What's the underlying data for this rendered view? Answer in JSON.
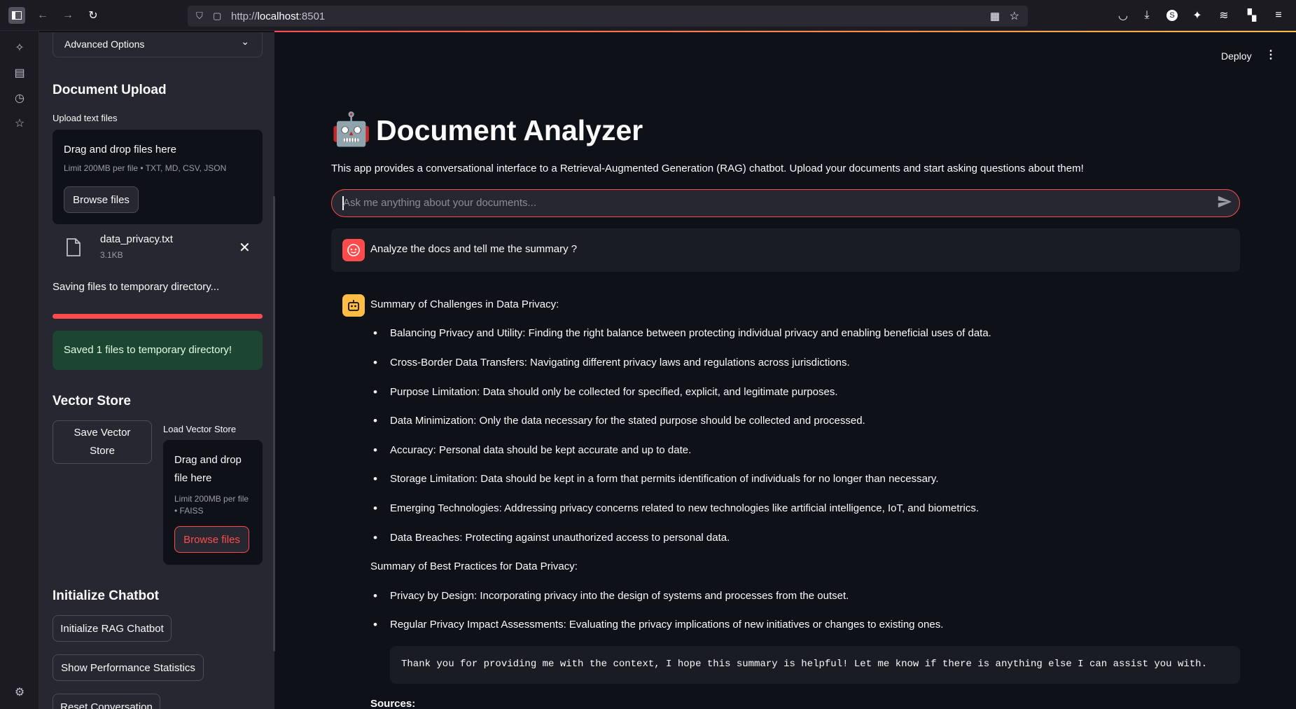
{
  "browser": {
    "url_prefix": "http://",
    "url_host": "localhost",
    "url_port": ":8501"
  },
  "sidebar": {
    "advanced_options": "Advanced Options",
    "document_upload_title": "Document Upload",
    "upload_label": "Upload text files",
    "drop_text": "Drag and drop files here",
    "drop_limit": "Limit 200MB per file • TXT, MD, CSV, JSON",
    "browse_button": "Browse files",
    "file_name": "data_privacy.txt",
    "file_size": "3.1KB",
    "saving_text": "Saving files to temporary directory...",
    "progress": 1.0,
    "success_text": "Saved 1 files to temporary directory!",
    "vector_store_title": "Vector Store",
    "save_vector_button": "Save Vector Store",
    "load_vector_label": "Load Vector Store",
    "load_drop_text": "Drag and drop file here",
    "load_drop_limit": "Limit 200MB per file • FAISS",
    "load_browse_button": "Browse files",
    "initialize_title": "Initialize Chatbot",
    "init_button": "Initialize RAG Chatbot",
    "perf_button": "Show Performance Statistics",
    "reset_button": "Reset Conversation"
  },
  "header": {
    "deploy": "Deploy"
  },
  "main": {
    "title_emoji": "🤖",
    "title": "Document Analyzer",
    "description": "This app provides a conversational interface to a Retrieval-Augmented Generation (RAG) chatbot. Upload your documents and start asking questions about them!",
    "chat_placeholder": "Ask me anything about your documents...",
    "user_message": "Analyze the docs and tell me the summary ?",
    "bot_heading1": "Summary of Challenges in Data Privacy:",
    "challenges": [
      "Balancing Privacy and Utility: Finding the right balance between protecting individual privacy and enabling beneficial uses of data.",
      "Cross-Border Data Transfers: Navigating different privacy laws and regulations across jurisdictions.",
      "Purpose Limitation: Data should only be collected for specified, explicit, and legitimate purposes.",
      "Data Minimization: Only the data necessary for the stated purpose should be collected and processed.",
      "Accuracy: Personal data should be kept accurate and up to date.",
      "Storage Limitation: Data should be kept in a form that permits identification of individuals for no longer than necessary.",
      "Emerging Technologies: Addressing privacy concerns related to new technologies like artificial intelligence, IoT, and biometrics.",
      "Data Breaches: Protecting against unauthorized access to personal data."
    ],
    "bot_heading2": "Summary of Best Practices for Data Privacy:",
    "practices": [
      "Privacy by Design: Incorporating privacy into the design of systems and processes from the outset.",
      "Regular Privacy Impact Assessments: Evaluating the privacy implications of new initiatives or changes to existing ones."
    ],
    "code_text": "Thank you for providing me with the context, I hope this summary is helpful! Let me know if there is anything else I can assist you with.",
    "sources_label": "Sources:"
  },
  "colors": {
    "accent": "#ff4b4b",
    "success_bg": "#1c4532",
    "bot_avatar": "#ffbd45"
  }
}
